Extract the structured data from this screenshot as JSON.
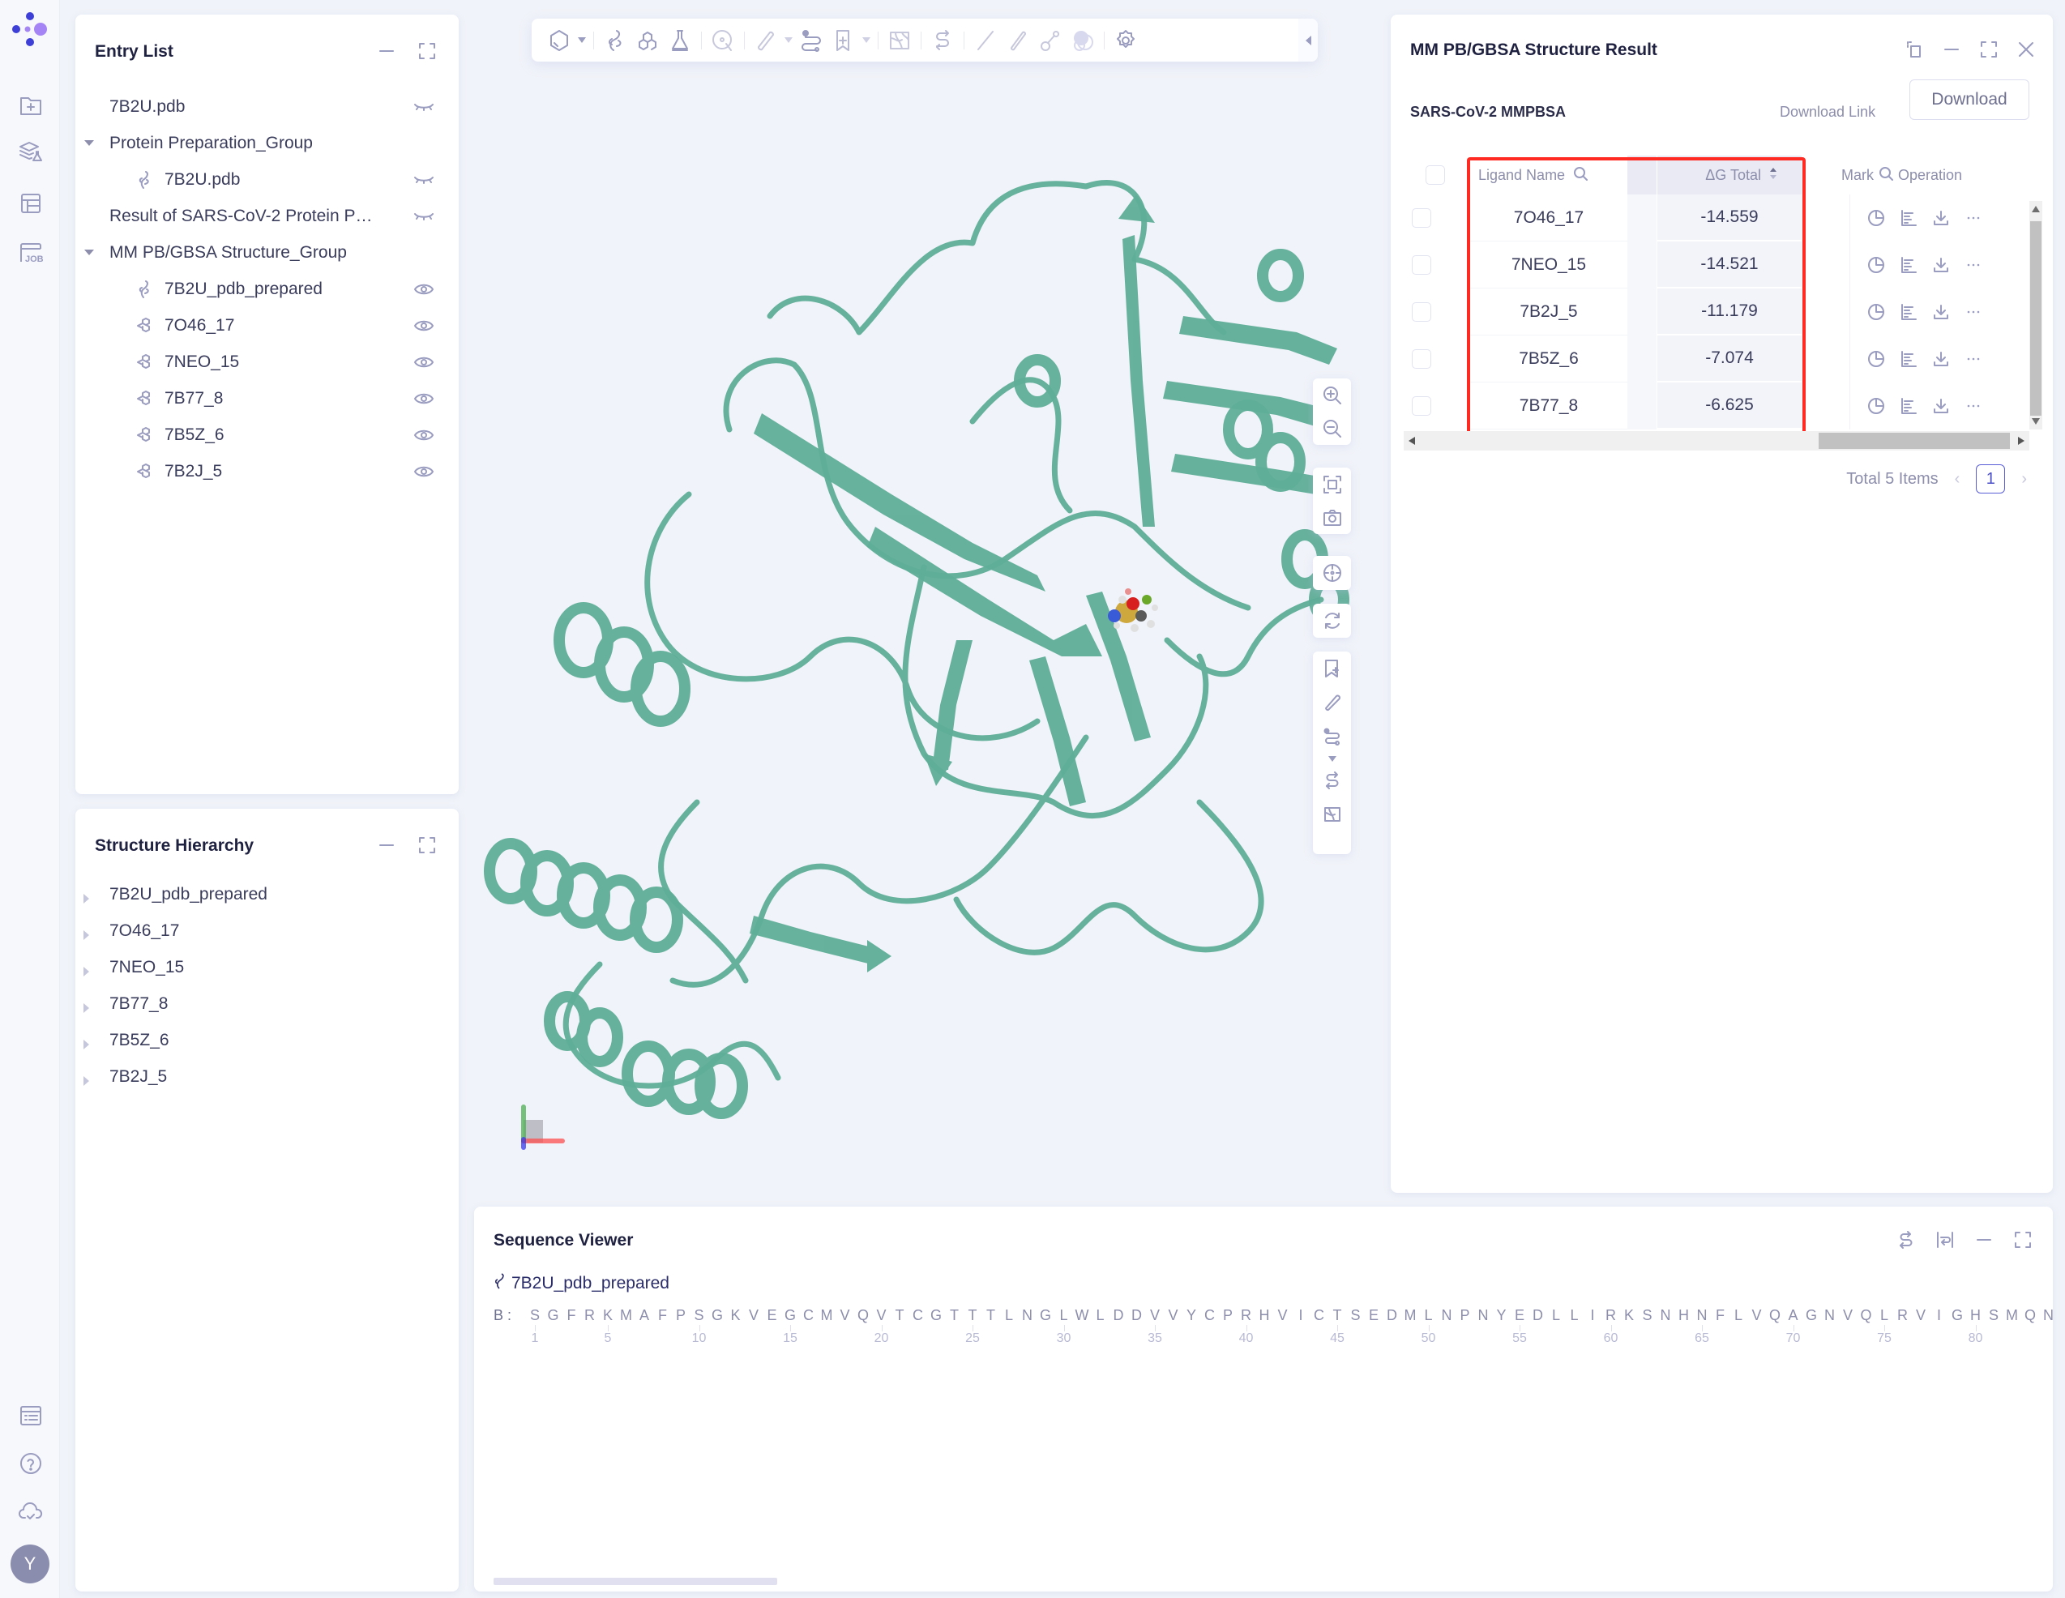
{
  "rail": {
    "top_icons": [
      "add-folder-icon",
      "layers-flask-icon",
      "table-layout-icon",
      "job-icon"
    ],
    "bottom_icons": [
      "list-card-icon",
      "help-icon",
      "cloud-check-icon"
    ],
    "avatar_initial": "Y"
  },
  "entry_list": {
    "title": "Entry List",
    "items": [
      {
        "label": "7B2U.pdb",
        "level": 0,
        "type": "file",
        "visible": false
      },
      {
        "label": "Protein Preparation_Group",
        "level": 0,
        "type": "group",
        "expanded": true
      },
      {
        "label": "7B2U.pdb",
        "level": 1,
        "type": "protein",
        "visible": false
      },
      {
        "label": "Result of SARS-CoV-2 Protein Prepar...",
        "level": 0,
        "type": "file",
        "visible": false
      },
      {
        "label": "MM PB/GBSA Structure_Group",
        "level": 0,
        "type": "group",
        "expanded": true
      },
      {
        "label": "7B2U_pdb_prepared",
        "level": 1,
        "type": "protein",
        "visible": true
      },
      {
        "label": "7O46_17",
        "level": 1,
        "type": "ligand",
        "visible": true
      },
      {
        "label": "7NEO_15",
        "level": 1,
        "type": "ligand",
        "visible": true
      },
      {
        "label": "7B77_8",
        "level": 1,
        "type": "ligand",
        "visible": true
      },
      {
        "label": "7B5Z_6",
        "level": 1,
        "type": "ligand",
        "visible": true
      },
      {
        "label": "7B2J_5",
        "level": 1,
        "type": "ligand",
        "visible": true
      }
    ]
  },
  "structure_hierarchy": {
    "title": "Structure Hierarchy",
    "items": [
      "7B2U_pdb_prepared",
      "7O46_17",
      "7NEO_15",
      "7B77_8",
      "7B5Z_6",
      "7B2J_5"
    ]
  },
  "toolbar": {
    "items": [
      "select-shape-icon",
      "protein-icon",
      "molecule-icon",
      "flask-icon",
      "pick-atom-icon",
      "measure-icon",
      "path-icon",
      "bookmark-add-icon",
      "surface-map-icon",
      "superpose-icon",
      "line-icon",
      "stick-icon",
      "ball-stick-icon",
      "spacefill-icon",
      "settings-icon"
    ]
  },
  "viewer_tools": [
    "zoom-in-icon",
    "zoom-out-icon",
    "fit-view-icon",
    "screenshot-icon",
    "center-icon",
    "rotate-icon",
    "bookmark-add-icon",
    "measure-icon",
    "path-icon",
    "superpose-icon",
    "surface-map-icon"
  ],
  "result_panel": {
    "title": "MM PB/GBSA Structure Result",
    "subtitle": "SARS-CoV-2 MMPBSA",
    "download_link": "Download Link",
    "download_button": "Download",
    "columns": {
      "ligand_name": "Ligand Name",
      "dg_total": "ΔG Total",
      "mark": "Mark",
      "operation": "Operation"
    },
    "rows": [
      {
        "ligand": "7O46_17",
        "dg_total": "-14.559"
      },
      {
        "ligand": "7NEO_15",
        "dg_total": "-14.521"
      },
      {
        "ligand": "7B2J_5",
        "dg_total": "-11.179"
      },
      {
        "ligand": "7B5Z_6",
        "dg_total": "-7.074"
      },
      {
        "ligand": "7B77_8",
        "dg_total": "-6.625"
      }
    ],
    "total_text": "Total 5 Items",
    "current_page": "1",
    "highlight_color": "#ff2a22"
  },
  "sequence_viewer": {
    "title": "Sequence Viewer",
    "entry": "7B2U_pdb_prepared",
    "chain_label": "B :",
    "residues": [
      "S",
      "G",
      "F",
      "R",
      "K",
      "M",
      "A",
      "F",
      "P",
      "S",
      "G",
      "K",
      "V",
      "E",
      "G",
      "C",
      "M",
      "V",
      "Q",
      "V",
      "T",
      "C",
      "G",
      "T",
      "T",
      "T",
      "L",
      "N",
      "G",
      "L",
      "W",
      "L",
      "D",
      "D",
      "V",
      "V",
      "Y",
      "C",
      "P",
      "R",
      "H",
      "V",
      "I",
      "C",
      "T",
      "S",
      "E",
      "D",
      "M",
      "L",
      "N",
      "P",
      "N",
      "Y",
      "E",
      "D",
      "L",
      "L",
      "I",
      "R",
      "K",
      "S",
      "N",
      "H",
      "N",
      "F",
      "L",
      "V",
      "Q",
      "A",
      "G",
      "N",
      "V",
      "Q",
      "L",
      "R",
      "V",
      "I",
      "G",
      "H",
      "S",
      "M",
      "Q",
      "N"
    ],
    "tick_labels": [
      "1",
      "5",
      "10",
      "15",
      "20",
      "25",
      "30",
      "35",
      "40",
      "45",
      "50",
      "55",
      "60",
      "65",
      "70",
      "75",
      "80"
    ]
  },
  "colors": {
    "protein_ribbon": "#5fae98",
    "accent": "#4b50c8",
    "icon": "#9a9cc0"
  }
}
